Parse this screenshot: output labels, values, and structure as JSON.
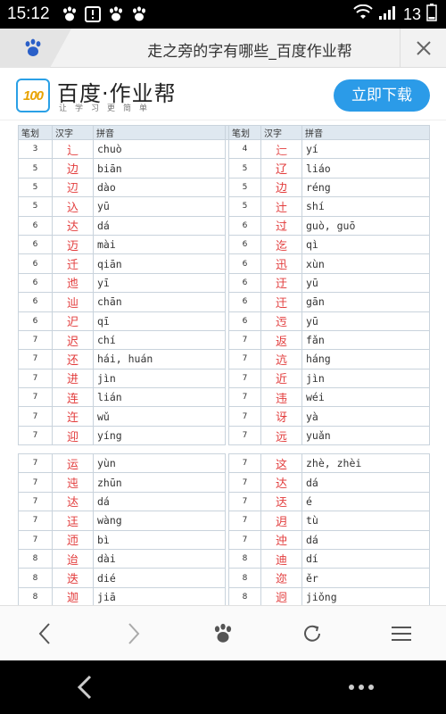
{
  "status_bar": {
    "time": "15:12",
    "battery": "13",
    "left_icons": [
      "baidu-paw-icon",
      "download-icon",
      "baidu-paw-icon",
      "baidu-paw-icon"
    ],
    "right_icons": [
      "wifi-icon",
      "signal-icon",
      "battery-icon"
    ]
  },
  "browser": {
    "page_title": "走之旁的字有哪些_百度作业帮",
    "close_icon": "close-icon",
    "tab_logo": "baidu-paw-icon"
  },
  "banner": {
    "logo_text": "100",
    "brand": "百度·作业帮",
    "slogan": "让学习更简单",
    "download_label": "立即下载"
  },
  "table": {
    "headers": [
      "笔划",
      "汉字",
      "拼音",
      "笔划",
      "汉字",
      "拼音"
    ],
    "section1": [
      {
        "s1": "3",
        "c1": "辶",
        "p1": "chuò",
        "s2": "4",
        "c2": "辷",
        "p2": "yí"
      },
      {
        "s1": "5",
        "c1": "边",
        "p1": "biān",
        "s2": "5",
        "c2": "辽",
        "p2": "liáo"
      },
      {
        "s1": "5",
        "c1": "辺",
        "p1": "dào",
        "s2": "5",
        "c2": "边",
        "p2": "réng"
      },
      {
        "s1": "5",
        "c1": "込",
        "p1": "yū",
        "s2": "5",
        "c2": "辻",
        "p2": "shí"
      },
      {
        "s1": "6",
        "c1": "达",
        "p1": "dá",
        "s2": "6",
        "c2": "过",
        "p2": "guò, guō"
      },
      {
        "s1": "6",
        "c1": "迈",
        "p1": "mài",
        "s2": "6",
        "c2": "迄",
        "p2": "qì"
      },
      {
        "s1": "6",
        "c1": "迁",
        "p1": "qiān",
        "s2": "6",
        "c2": "迅",
        "p2": "xùn"
      },
      {
        "s1": "6",
        "c1": "迆",
        "p1": "yī",
        "s2": "6",
        "c2": "迂",
        "p2": "yū"
      },
      {
        "s1": "6",
        "c1": "辿",
        "p1": "chān",
        "s2": "6",
        "c2": "迀",
        "p2": "gān"
      },
      {
        "s1": "6",
        "c1": "迉",
        "p1": "qī",
        "s2": "6",
        "c2": "迃",
        "p2": "yū"
      },
      {
        "s1": "7",
        "c1": "迟",
        "p1": "chí",
        "s2": "7",
        "c2": "返",
        "p2": "fǎn"
      },
      {
        "s1": "7",
        "c1": "还",
        "p1": "hái, huán",
        "s2": "7",
        "c2": "迒",
        "p2": "háng"
      },
      {
        "s1": "7",
        "c1": "进",
        "p1": "jìn",
        "s2": "7",
        "c2": "近",
        "p2": "jìn"
      },
      {
        "s1": "7",
        "c1": "连",
        "p1": "lián",
        "s2": "7",
        "c2": "违",
        "p2": "wéi"
      },
      {
        "s1": "7",
        "c1": "迕",
        "p1": "wǔ",
        "s2": "7",
        "c2": "讶",
        "p2": "yà"
      },
      {
        "s1": "7",
        "c1": "迎",
        "p1": "yíng",
        "s2": "7",
        "c2": "远",
        "p2": "yuǎn"
      }
    ],
    "section2": [
      {
        "s1": "7",
        "c1": "运",
        "p1": "yùn",
        "s2": "7",
        "c2": "这",
        "p2": "zhè, zhèi"
      },
      {
        "s1": "7",
        "c1": "迍",
        "p1": "zhūn",
        "s2": "7",
        "c2": "达",
        "p2": "dá"
      },
      {
        "s1": "7",
        "c1": "迏",
        "p1": "dá",
        "s2": "7",
        "c2": "迗",
        "p2": "é"
      },
      {
        "s1": "7",
        "c1": "迋",
        "p1": "wàng",
        "s2": "7",
        "c2": "迌",
        "p2": "tù"
      },
      {
        "s1": "7",
        "c1": "迊",
        "p1": "bì",
        "s2": "7",
        "c2": "迚",
        "p2": "dá"
      },
      {
        "s1": "8",
        "c1": "迨",
        "p1": "dài",
        "s2": "8",
        "c2": "迪",
        "p2": "dí"
      },
      {
        "s1": "8",
        "c1": "迭",
        "p1": "dié",
        "s2": "8",
        "c2": "迩",
        "p2": "ěr"
      },
      {
        "s1": "8",
        "c1": "迦",
        "p1": "jiā",
        "s2": "8",
        "c2": "迥",
        "p2": "jiǒng"
      }
    ]
  },
  "toolbar": {
    "items": [
      {
        "name": "back-icon"
      },
      {
        "name": "forward-icon"
      },
      {
        "name": "baidu-home-icon"
      },
      {
        "name": "refresh-icon"
      },
      {
        "name": "menu-icon"
      }
    ]
  },
  "navbar": {
    "items": [
      "system-back-icon",
      "more-icon"
    ]
  }
}
